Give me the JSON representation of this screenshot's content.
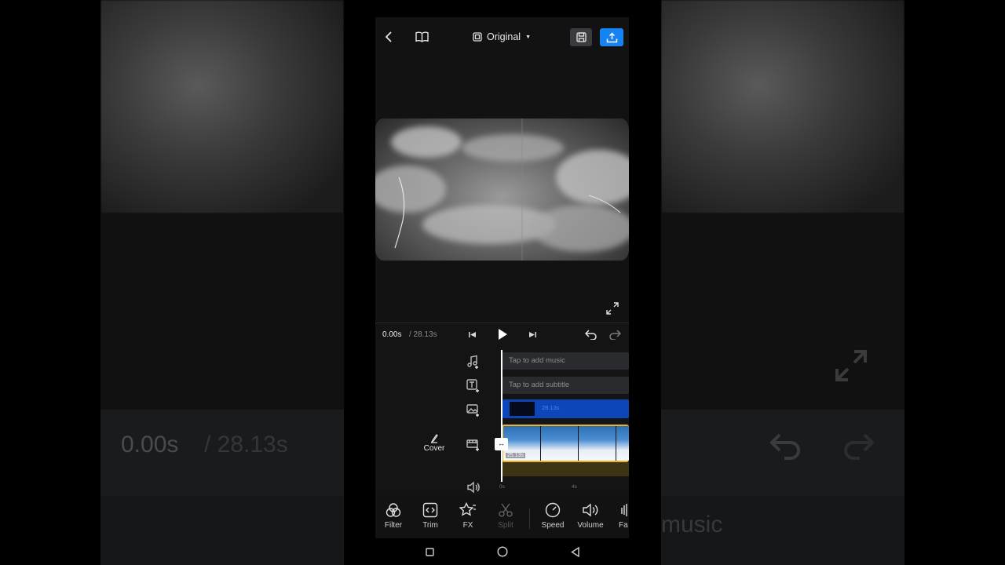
{
  "header": {
    "aspect_label": "Original",
    "back_icon": "chevron-left-icon",
    "tutorial_icon": "book-icon",
    "save_icon": "save-icon",
    "export_icon": "upload-icon",
    "accent_color": "#1683f3"
  },
  "transport": {
    "current_time": "0.00s",
    "total_time": "/ 28.13s"
  },
  "tracks": {
    "music_placeholder": "Tap to add music",
    "subtitle_placeholder": "Tap to add subtitle",
    "pip_duration": "28.13s",
    "video_duration": "25.13s",
    "cover_label": "Cover",
    "handle_glyph": "↔"
  },
  "ruler": {
    "marks": [
      "0s",
      "4s"
    ]
  },
  "toolbar": {
    "items": [
      {
        "label": "Filter",
        "icon": "filter-icon"
      },
      {
        "label": "Trim",
        "icon": "trim-icon"
      },
      {
        "label": "FX",
        "icon": "fx-star-icon"
      },
      {
        "label": "Split",
        "icon": "scissors-icon"
      },
      {
        "label": "Speed",
        "icon": "speed-gauge-icon"
      },
      {
        "label": "Volume",
        "icon": "volume-icon"
      },
      {
        "label": "Fa",
        "icon": "fade-icon"
      }
    ]
  },
  "background_ghost": {
    "left_time": "0.00s",
    "left_total": "/ 28.13s",
    "right_text": "music"
  }
}
